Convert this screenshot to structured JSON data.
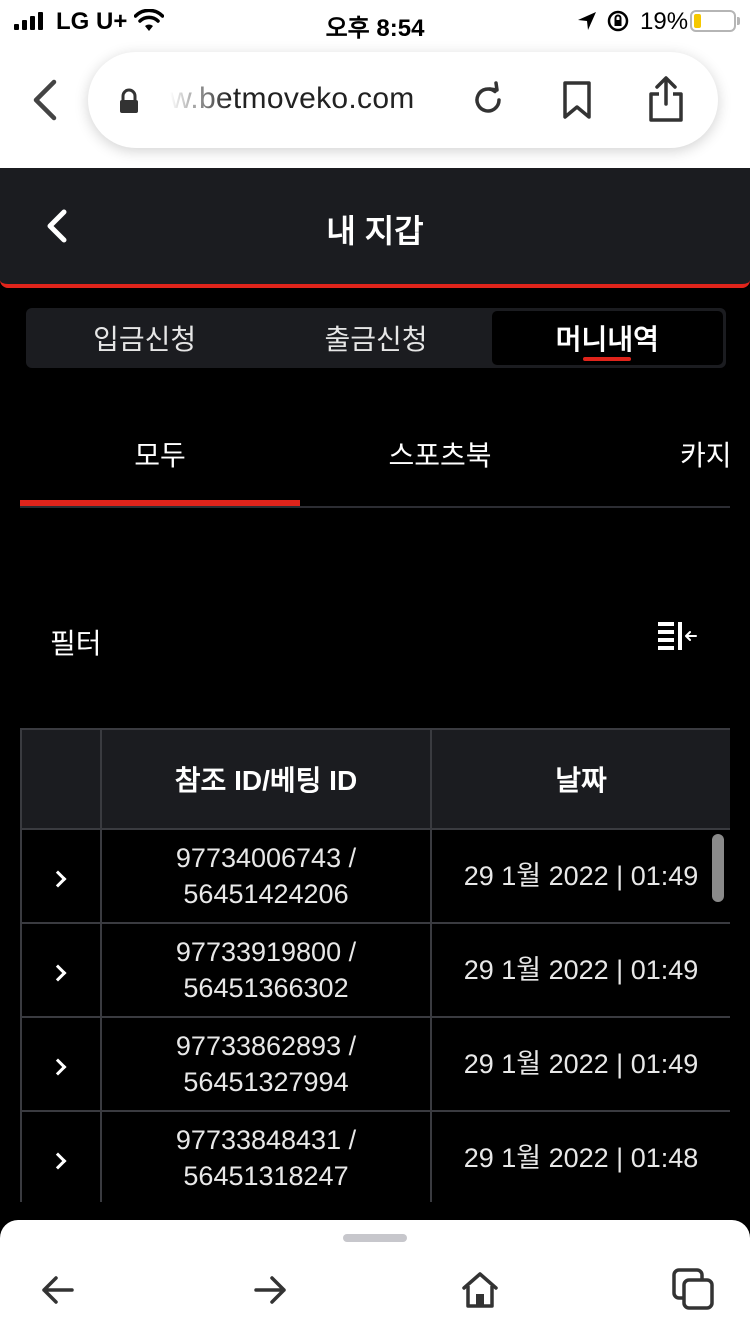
{
  "status_bar": {
    "carrier": "LG U+",
    "time": "오후 8:54",
    "battery_text": "19%",
    "battery_level": 0.19,
    "battery_color": "#f5c800"
  },
  "browser": {
    "url": "w.betmoveko.com",
    "icons": [
      "back-icon",
      "lock-icon",
      "reload-icon",
      "bookmark-icon",
      "share-icon"
    ]
  },
  "header": {
    "title": "내 지갑"
  },
  "seg_tabs": [
    {
      "label": "입금신청",
      "active": false
    },
    {
      "label": "출금신청",
      "active": false
    },
    {
      "label": "머니내역",
      "active": true
    }
  ],
  "category_tabs": [
    {
      "label": "모두",
      "active": true
    },
    {
      "label": "스포츠북",
      "active": false
    },
    {
      "label": "카지",
      "active": false
    }
  ],
  "filter": {
    "label": "필터"
  },
  "table": {
    "columns": [
      "",
      "참조 ID/베팅 ID",
      "날짜"
    ],
    "rows": [
      {
        "ref_id": "97734006743 /",
        "bet_id": "56451424206",
        "date": "29 1월 2022 | 01:49"
      },
      {
        "ref_id": "97733919800 /",
        "bet_id": "56451366302",
        "date": "29 1월 2022 | 01:49"
      },
      {
        "ref_id": "97733862893 /",
        "bet_id": "56451327994",
        "date": "29 1월 2022 | 01:49"
      },
      {
        "ref_id": "97733848431 /",
        "bet_id": "56451318247",
        "date": "29 1월 2022 | 01:48"
      }
    ]
  },
  "colors": {
    "accent": "#e0241b",
    "panel": "#1b1c20",
    "background": "#000000"
  }
}
